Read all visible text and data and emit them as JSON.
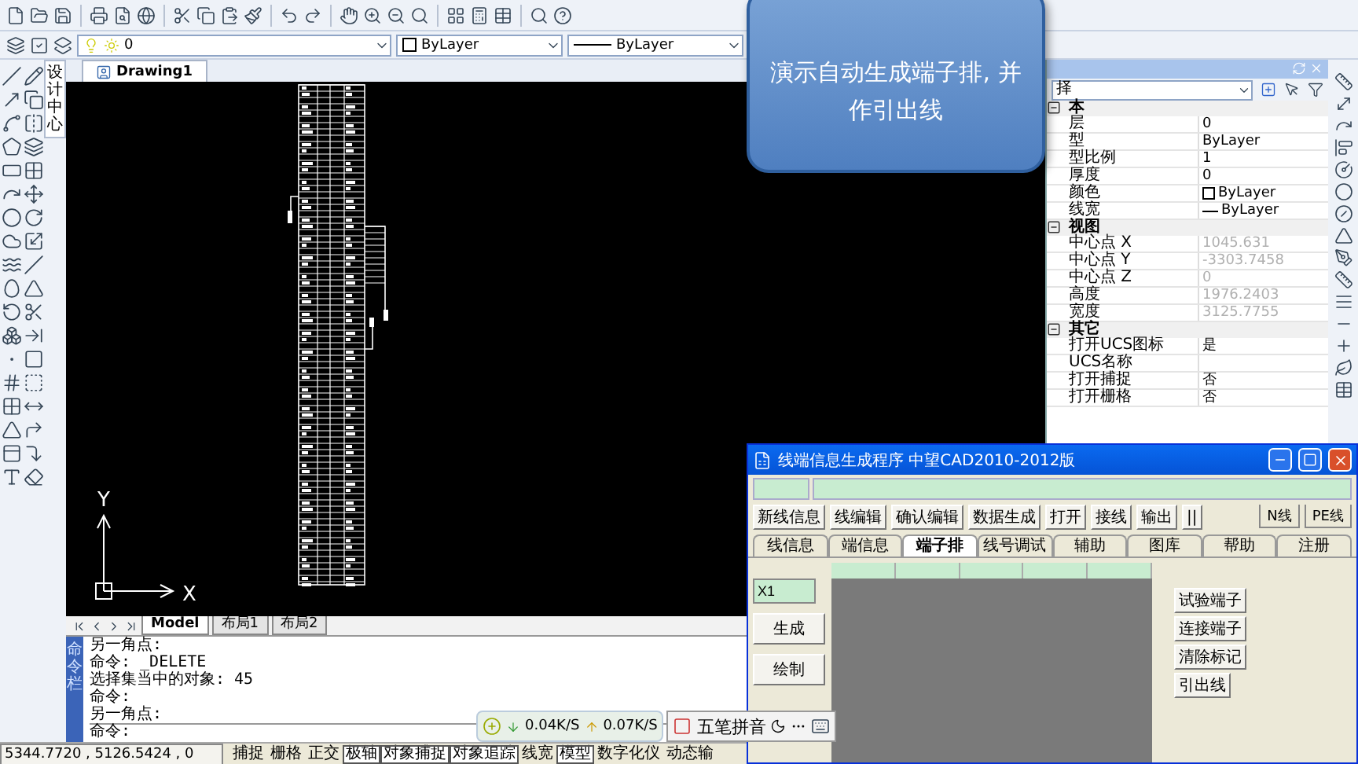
{
  "callout": {
    "text": "演示自动生成端子排, 并作引出线"
  },
  "layer_bar": {
    "layer": "0",
    "color_mode": "ByLayer",
    "linetype": "ByLayer"
  },
  "side_tab": {
    "label": "设计中心"
  },
  "document_tab": {
    "label": "Drawing1"
  },
  "axis": {
    "x": "X",
    "y": "Y"
  },
  "layout_tabs": [
    {
      "label": "Model",
      "selected": true
    },
    {
      "label": "布局1",
      "selected": false
    },
    {
      "label": "布局2",
      "selected": false
    }
  ],
  "command": {
    "title": "命令栏",
    "history": [
      "另一角点:",
      "命令: _DELETE",
      "选择集当中的对象: 45",
      "命令:",
      "另一角点:"
    ],
    "prompt": "命令:"
  },
  "status_bar": {
    "coords": "5344.7720 , 5126.5424 , 0",
    "toggles": [
      {
        "label": "捕捉",
        "on": false
      },
      {
        "label": "栅格",
        "on": false
      },
      {
        "label": "正交",
        "on": false
      },
      {
        "label": "极轴",
        "on": true
      },
      {
        "label": "对象捕捉",
        "on": true
      },
      {
        "label": "对象追踪",
        "on": true
      },
      {
        "label": "线宽",
        "on": false
      },
      {
        "label": "模型",
        "on": true
      },
      {
        "label": "数字化仪",
        "on": false
      },
      {
        "label": "动态输",
        "on": false
      }
    ]
  },
  "properties": {
    "selector": "择",
    "sections": [
      {
        "title": "本",
        "expanded": true,
        "rows": [
          {
            "label": "层",
            "value": "0",
            "disabled": false
          },
          {
            "label": "型",
            "value": "ByLayer",
            "disabled": false
          },
          {
            "label": "型比例",
            "value": "1",
            "disabled": false
          },
          {
            "label": "厚度",
            "value": "0",
            "disabled": false
          },
          {
            "label": "颜色",
            "value": "ByLayer",
            "disabled": false,
            "kind": "color"
          },
          {
            "label": "线宽",
            "value": "ByLayer",
            "disabled": false,
            "kind": "lineweight"
          }
        ]
      },
      {
        "title": "视图",
        "expanded": true,
        "rows": [
          {
            "label": "中心点 X",
            "value": "1045.631",
            "disabled": true
          },
          {
            "label": "中心点 Y",
            "value": "-3303.7458",
            "disabled": true
          },
          {
            "label": "中心点 Z",
            "value": "0",
            "disabled": true
          },
          {
            "label": "高度",
            "value": "1976.2403",
            "disabled": true
          },
          {
            "label": "宽度",
            "value": "3125.7755",
            "disabled": true
          }
        ]
      },
      {
        "title": "其它",
        "expanded": true,
        "rows": [
          {
            "label": "打开UCS图标",
            "value": "是",
            "disabled": false
          },
          {
            "label": "UCS名称",
            "value": "",
            "disabled": false
          },
          {
            "label": "打开捕捉",
            "value": "否",
            "disabled": false
          },
          {
            "label": "打开栅格",
            "value": "否",
            "disabled": false
          }
        ]
      }
    ]
  },
  "dialog": {
    "title": "线端信息生成程序  中望CAD2010-2012版",
    "buttons": [
      "新线信息",
      "线编辑",
      "确认编辑",
      "数据生成",
      "打开",
      "接线",
      "输出",
      "||"
    ],
    "side_tabs": [
      "N线",
      "PE线"
    ],
    "tabs": [
      {
        "label": "线信息",
        "selected": false
      },
      {
        "label": "端信息",
        "selected": false
      },
      {
        "label": "端子排",
        "selected": true
      },
      {
        "label": "线号调试",
        "selected": false
      },
      {
        "label": "辅助",
        "selected": false
      },
      {
        "label": "图库",
        "selected": false
      },
      {
        "label": "帮助",
        "selected": false
      },
      {
        "label": "注册",
        "selected": false
      }
    ],
    "name_value": "X1",
    "left_buttons": [
      "生成",
      "绘制"
    ],
    "right_buttons": [
      "试验端子",
      "连接端子",
      "清除标记",
      "引出线"
    ]
  },
  "net_meter": {
    "down": "0.04K/S",
    "up": "0.07K/S"
  },
  "ime": {
    "label": "五笔拼音"
  }
}
